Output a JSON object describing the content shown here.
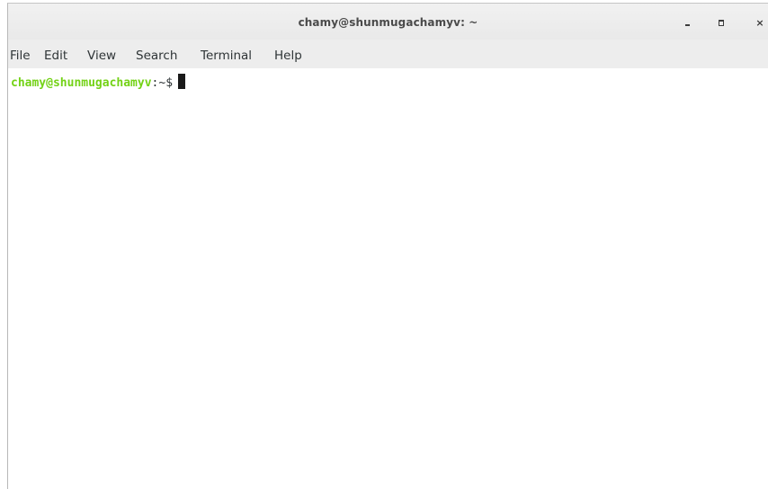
{
  "window": {
    "title": "chamy@shunmugachamyv: ~",
    "minimize_glyph": "minimize-icon",
    "maximize_glyph": "maximize-icon",
    "close_label": "×"
  },
  "menubar": {
    "items": [
      "File",
      "Edit",
      "View",
      "Search",
      "Terminal",
      "Help"
    ]
  },
  "terminal": {
    "user_host": "chamy@shunmugachamyv",
    "prompt_suffix": ":~$",
    "input": "",
    "colors": {
      "prompt": "#73d216",
      "text": "#2e3436",
      "background": "#ffffff",
      "cursor": "#1a1a1a"
    }
  }
}
